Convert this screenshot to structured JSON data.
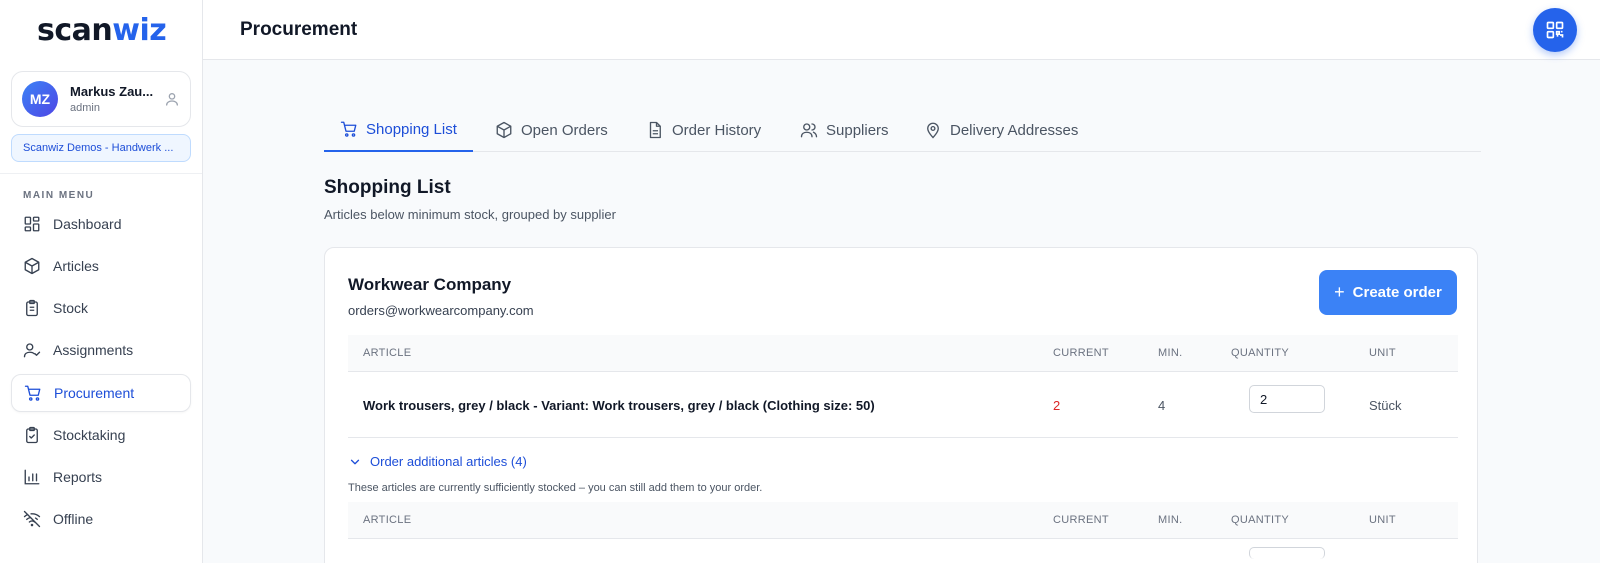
{
  "app": {
    "logo_part1": "scan",
    "logo_part2": "wiz",
    "brand_color": "#2563eb"
  },
  "user": {
    "initials": "MZ",
    "name": "Markus Zau...",
    "role": "admin"
  },
  "organization": "Scanwiz Demos - Handwerk ...",
  "sidebar": {
    "menu_title": "MAIN MENU",
    "items": [
      {
        "label": "Dashboard",
        "icon": "dashboard-icon"
      },
      {
        "label": "Articles",
        "icon": "box-icon"
      },
      {
        "label": "Stock",
        "icon": "clipboard-icon"
      },
      {
        "label": "Assignments",
        "icon": "user-check-icon"
      },
      {
        "label": "Procurement",
        "icon": "cart-icon",
        "active": true
      },
      {
        "label": "Stocktaking",
        "icon": "clipboard-check-icon"
      },
      {
        "label": "Reports",
        "icon": "bar-chart-icon"
      },
      {
        "label": "Offline",
        "icon": "wifi-off-icon"
      }
    ]
  },
  "header": {
    "title": "Procurement",
    "qr_button_icon": "qr-code-icon"
  },
  "tabs": [
    {
      "label": "Shopping List",
      "icon": "cart-icon",
      "active": true
    },
    {
      "label": "Open Orders",
      "icon": "box-icon"
    },
    {
      "label": "Order History",
      "icon": "document-icon"
    },
    {
      "label": "Suppliers",
      "icon": "users-icon"
    },
    {
      "label": "Delivery Addresses",
      "icon": "map-pin-icon"
    }
  ],
  "section": {
    "title": "Shopping List",
    "subtitle": "Articles below minimum stock, grouped by supplier"
  },
  "supplier": {
    "name": "Workwear Company",
    "email": "orders@workwearcompany.com",
    "create_order_label": "Create order",
    "columns": {
      "article": "ARTICLE",
      "current": "CURRENT",
      "min": "MIN.",
      "quantity": "QUANTITY",
      "unit": "UNIT"
    },
    "rows": [
      {
        "article": "Work trousers, grey / black - Variant: Work trousers, grey / black (Clothing size: 50)",
        "current": "2",
        "min": "4",
        "quantity": "2",
        "unit": "Stück"
      }
    ],
    "additional_toggle": "Order additional articles (4)",
    "additional_note": "These articles are currently sufficiently stocked – you can still add them to your order."
  }
}
